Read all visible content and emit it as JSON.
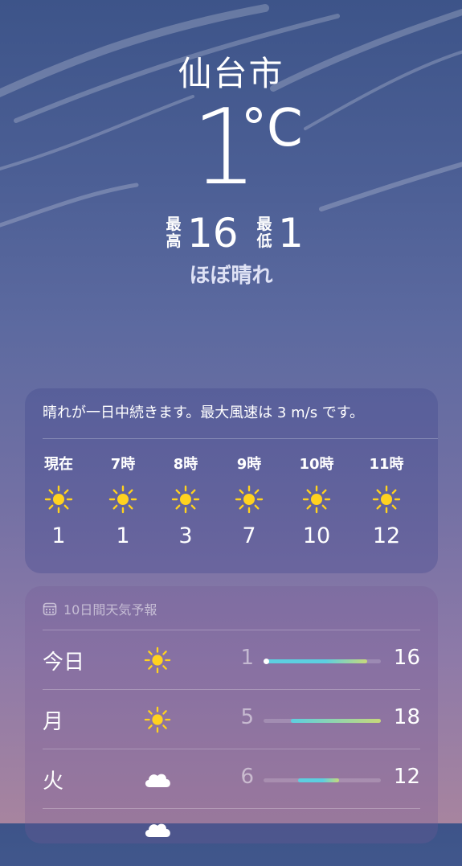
{
  "header": {
    "city": "仙台市",
    "temperature": "1",
    "unit": "°C",
    "high_label": "最高",
    "high_value": "16",
    "low_label": "最低",
    "low_value": "1",
    "condition": "ほぼ晴れ"
  },
  "hourly": {
    "summary": "晴れが一日中続きます。最大風速は 3 m/s です。",
    "items": [
      {
        "label": "現在",
        "icon": "sun-icon",
        "temp": "1"
      },
      {
        "label": "7時",
        "icon": "sun-icon",
        "temp": "1"
      },
      {
        "label": "8時",
        "icon": "sun-icon",
        "temp": "3"
      },
      {
        "label": "9時",
        "icon": "sun-icon",
        "temp": "7"
      },
      {
        "label": "10時",
        "icon": "sun-icon",
        "temp": "10"
      },
      {
        "label": "11時",
        "icon": "sun-icon",
        "temp": "12"
      }
    ]
  },
  "forecast": {
    "title": "10日間天気予報",
    "range_min": 1,
    "range_max": 18,
    "days": [
      {
        "day": "今日",
        "icon": "sun-icon",
        "low": "1",
        "high": "16",
        "current": 1
      },
      {
        "day": "月",
        "icon": "sun-icon",
        "low": "5",
        "high": "18"
      },
      {
        "day": "火",
        "icon": "cloud-icon",
        "low": "6",
        "high": "12"
      }
    ]
  },
  "colors": {
    "sun": "#FFD21F",
    "bar_cool": "#5ccfe0",
    "bar_warm": "#c7d97a"
  }
}
